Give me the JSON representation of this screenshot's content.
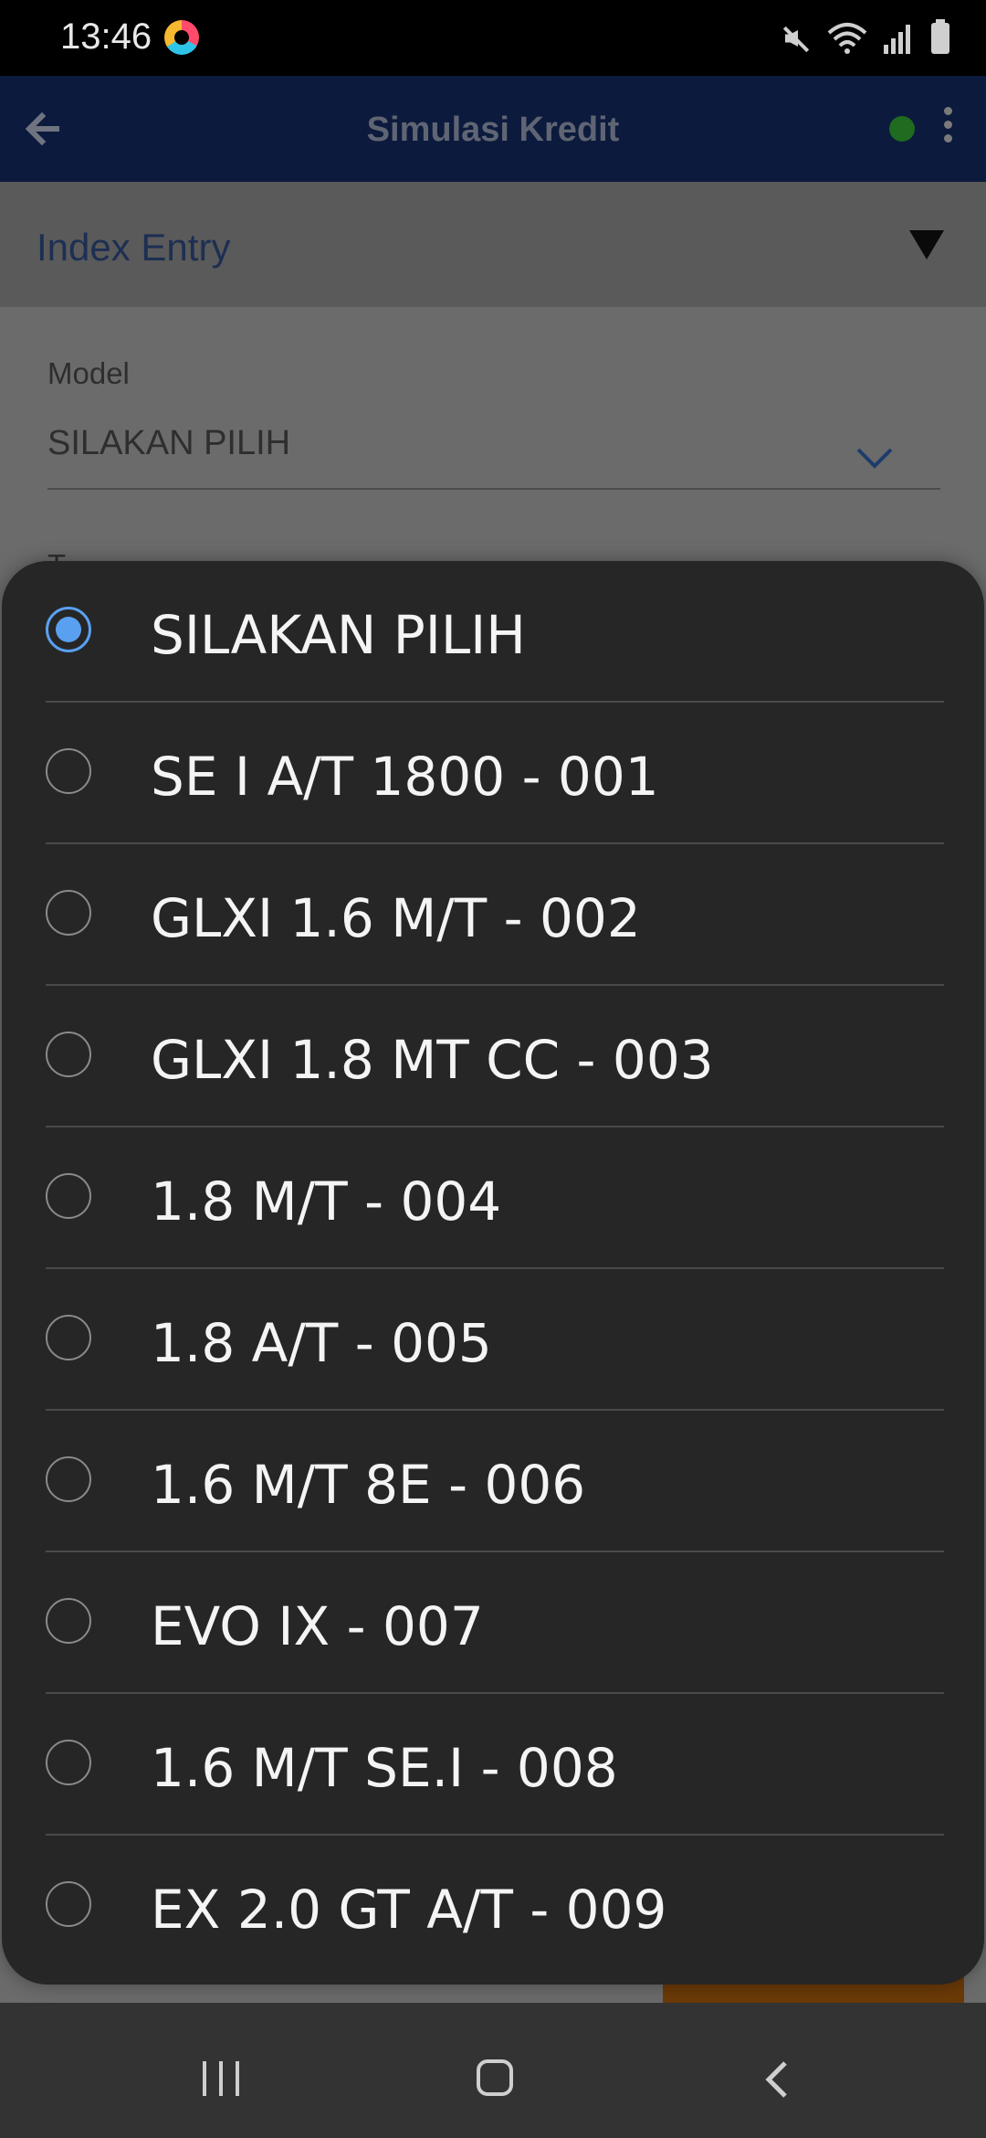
{
  "status_bar": {
    "time": "13:46"
  },
  "app_bar": {
    "title": "Simulasi Kredit",
    "status_dot_color": "#1f6b1f"
  },
  "section": {
    "title": "Index Entry"
  },
  "form": {
    "model_label": "Model",
    "model_value": "SILAKAN PILIH",
    "next_label_peek": "T..."
  },
  "dialog": {
    "accent_color": "#5aa0f0",
    "selected_index": 0,
    "options": [
      {
        "label": "SILAKAN PILIH",
        "selected": true
      },
      {
        "label": "SE I A/T 1800 - 001",
        "selected": false
      },
      {
        "label": "GLXI 1.6 M/T - 002",
        "selected": false
      },
      {
        "label": "GLXI 1.8 MT CC - 003",
        "selected": false
      },
      {
        "label": "1.8 M/T - 004",
        "selected": false
      },
      {
        "label": "1.8 A/T - 005",
        "selected": false
      },
      {
        "label": "1.6 M/T 8E - 006",
        "selected": false
      },
      {
        "label": "EVO IX - 007",
        "selected": false
      },
      {
        "label": "1.6 M/T SE.I - 008",
        "selected": false
      },
      {
        "label": "EX 2.0 GT A/T - 009",
        "selected": false
      }
    ]
  },
  "icons": {
    "back": "arrow-left-icon",
    "more": "more-vertical-icon",
    "dropdown": "chevron-down-icon",
    "collapse": "triangle-down-icon",
    "nav_recent": "recent-apps-icon",
    "nav_home": "home-icon",
    "nav_back": "nav-back-icon"
  }
}
